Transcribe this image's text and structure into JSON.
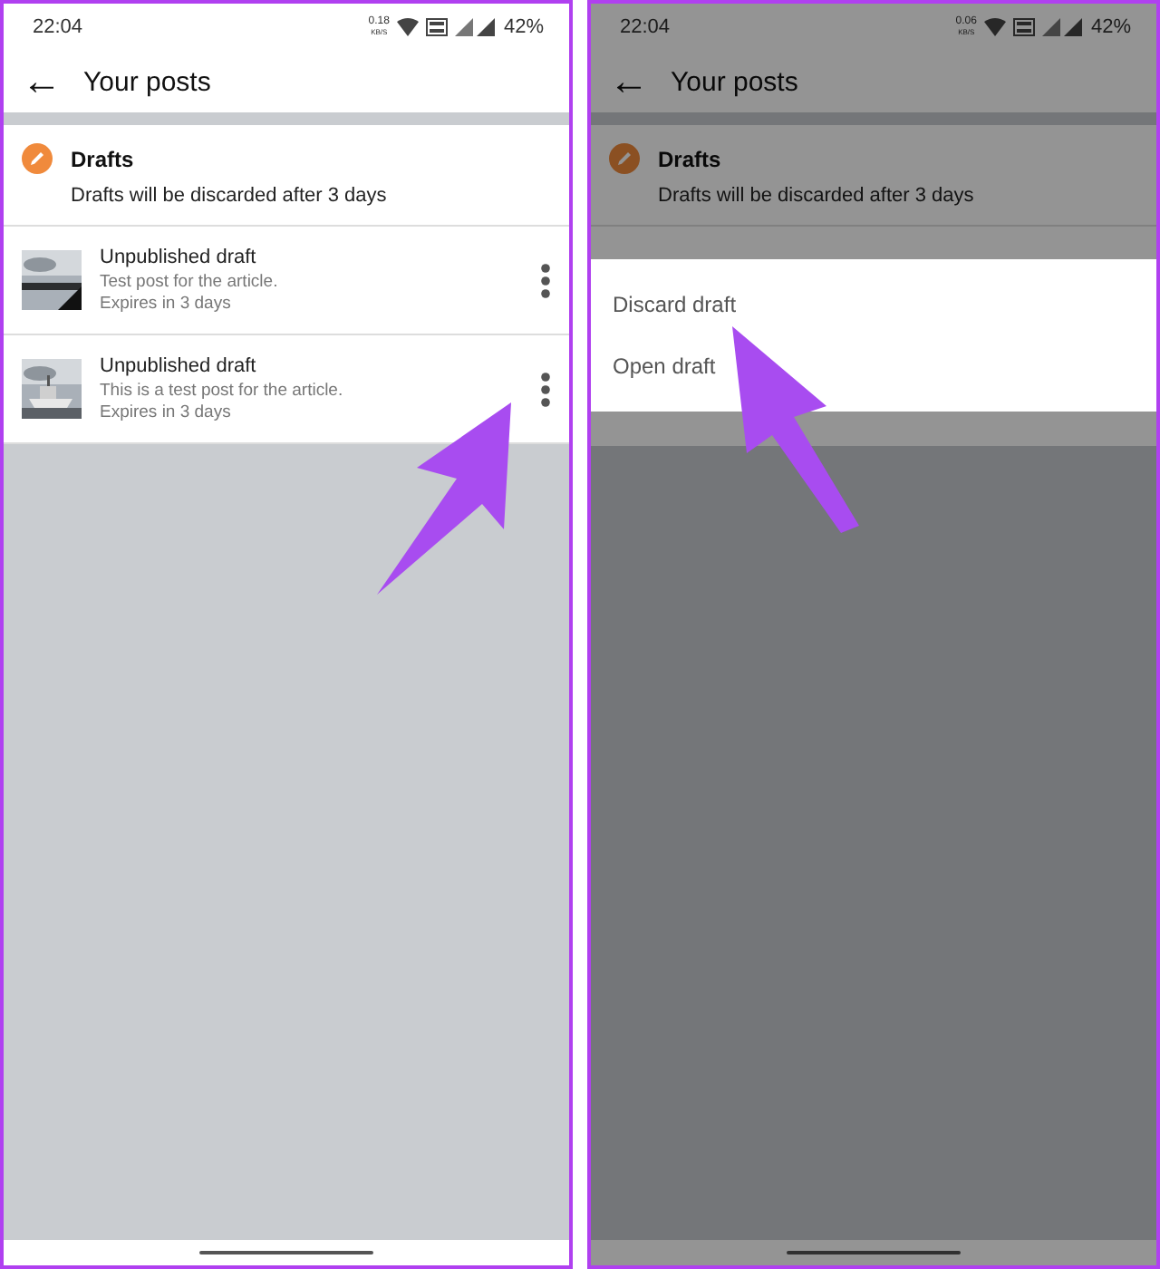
{
  "panels": [
    {
      "dimmed": false,
      "status_bar": {
        "time": "22:04",
        "speed_value": "0.18",
        "speed_unit": "KB/S",
        "battery": "42%"
      },
      "app_bar": {
        "back": "←",
        "title": "Your posts"
      },
      "drafts": {
        "title": "Drafts",
        "note": "Drafts will be discarded after 3 days"
      },
      "posts": [
        {
          "title": "Unpublished draft",
          "text": "Test post for the article.",
          "expires": "Expires in 3 days",
          "kind": "picture"
        },
        {
          "title": "Unpublished draft",
          "text": "This is a test post for the article.",
          "expires": "Expires in 3 days",
          "kind": "picture"
        }
      ]
    },
    {
      "dimmed": true,
      "status_bar": {
        "time": "22:04",
        "speed_value": "0.06",
        "speed_unit": "KB/S",
        "battery": "42%"
      },
      "app_bar": {
        "back": "←",
        "title": "Your posts"
      },
      "drafts": {
        "title": "Drafts",
        "note": "Drafts will be discarded after 3 days"
      },
      "menu": [
        "Discard draft",
        "Open draft"
      ]
    }
  ]
}
